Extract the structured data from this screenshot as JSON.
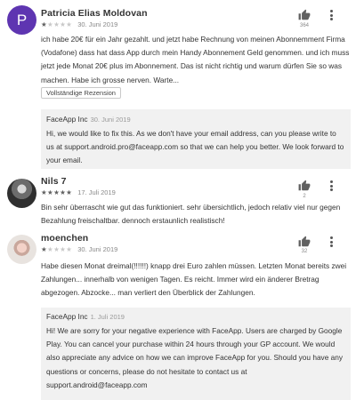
{
  "reviews": [
    {
      "author": "Patricia Elias Moldovan",
      "avatar_letter": "P",
      "rating": 1,
      "date": "30. Juni 2019",
      "helpful_count": "364",
      "text": "ich habe 20€ für ein Jahr gezahlt. und jetzt habe Rechnung von meinen Abonnemment Firma (Vodafone) dass hat dass App durch mein Handy Abonnement Geld genommen. und ich muss jetzt jede Monat 20€ plus im Abonnement. Das ist nicht richtig und warum dürfen Sie so was machen. Habe ich grosse nerven. Warte...",
      "full_review_label": "Vollständige Rezension",
      "developer_reply": {
        "name": "FaceApp Inc",
        "date": "30. Juni 2019",
        "text": "Hi, we would like to fix this. As we don't have your email address, can you please write to us at support.android.pro@faceapp.com so that we can help you better. We look forward to your email."
      }
    },
    {
      "author": "Nils 7",
      "rating": 5,
      "date": "17. Juli 2019",
      "helpful_count": "2",
      "text": "Bin sehr überrascht wie gut das funktioniert. sehr übersichtlich, jedoch relativ viel nur gegen Bezahlung freischaltbar. dennoch erstaunlich realistisch!"
    },
    {
      "author": "moenchen",
      "rating": 1,
      "date": "30. Juni 2019",
      "helpful_count": "32",
      "text": "Habe diesen Monat dreimal(!!!!!!) knapp drei Euro zahlen müssen. Letzten Monat bereits zwei Zahlungen... innerhalb von wenigen Tagen. Es reicht. Immer wird ein änderer Bretrag abgezogen. Abzocke... man verliert den Überblick der Zahlungen.",
      "developer_reply": {
        "name": "FaceApp Inc",
        "date": "1. Juli 2019",
        "text": "Hi! We are sorry for your negative experience with FaceApp. Users are charged by Google Play. You can cancel your purchase within 24 hours through your GP account. We would also appreciate any advice on how we can improve FaceApp for you. Should you have any questions or concerns, please do not hesitate to contact us at support.android@faceapp.com"
      }
    }
  ],
  "icons": {
    "thumb": "thumbs-up-icon",
    "more": "more-vert-icon",
    "star": "star-icon"
  },
  "colors": {
    "avatar_purple": "#5e35b1",
    "reply_background": "#f1f1f1",
    "star_filled": "#616161",
    "star_empty": "#c8c8c8"
  }
}
